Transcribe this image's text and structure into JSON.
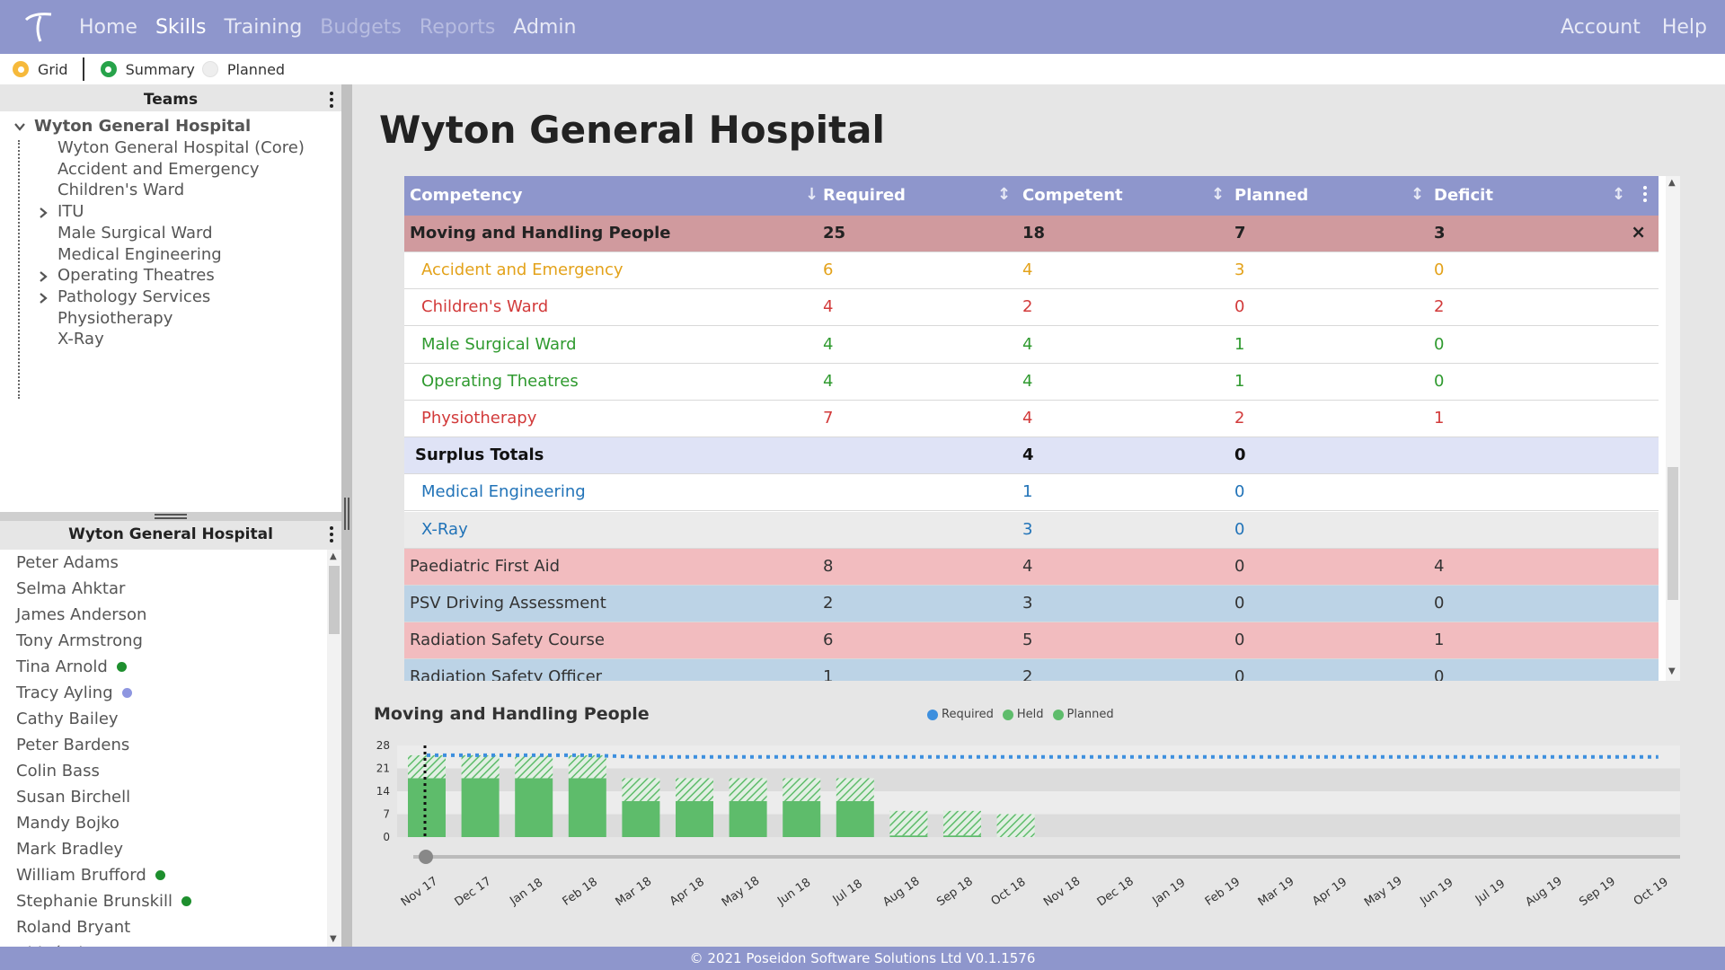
{
  "nav": {
    "items": [
      {
        "label": "Home",
        "state": "normal"
      },
      {
        "label": "Skills",
        "state": "active"
      },
      {
        "label": "Training",
        "state": "normal"
      },
      {
        "label": "Budgets",
        "state": "disabled"
      },
      {
        "label": "Reports",
        "state": "disabled"
      },
      {
        "label": "Admin",
        "state": "normal"
      }
    ],
    "right": [
      {
        "label": "Account"
      },
      {
        "label": "Help"
      }
    ]
  },
  "toolbar": {
    "grid": "Grid",
    "summary": "Summary",
    "planned": "Planned"
  },
  "teams": {
    "header": "Teams",
    "root": "Wyton General Hospital",
    "items": [
      {
        "label": "Wyton General Hospital (Core)",
        "expandable": false
      },
      {
        "label": "Accident and Emergency",
        "expandable": false
      },
      {
        "label": "Children's Ward",
        "expandable": false
      },
      {
        "label": "ITU",
        "expandable": true
      },
      {
        "label": "Male Surgical Ward",
        "expandable": false
      },
      {
        "label": "Medical Engineering",
        "expandable": false
      },
      {
        "label": "Operating Theatres",
        "expandable": true
      },
      {
        "label": "Pathology Services",
        "expandable": true
      },
      {
        "label": "Physiotherapy",
        "expandable": false
      },
      {
        "label": "X-Ray",
        "expandable": false
      }
    ]
  },
  "people": {
    "header": "Wyton General Hospital",
    "items": [
      {
        "name": "Peter Adams",
        "dot": ""
      },
      {
        "name": "Selma Ahktar",
        "dot": ""
      },
      {
        "name": "James Anderson",
        "dot": ""
      },
      {
        "name": "Tony Armstrong",
        "dot": ""
      },
      {
        "name": "Tina Arnold",
        "dot": "#1e8f2e"
      },
      {
        "name": "Tracy Ayling",
        "dot": "#8e96e0"
      },
      {
        "name": "Cathy Bailey",
        "dot": ""
      },
      {
        "name": "Peter Bardens",
        "dot": ""
      },
      {
        "name": "Colin Bass",
        "dot": ""
      },
      {
        "name": "Susan Birchell",
        "dot": ""
      },
      {
        "name": "Mandy Bojko",
        "dot": ""
      },
      {
        "name": "Mark Bradley",
        "dot": ""
      },
      {
        "name": "William Brufford",
        "dot": "#1e8f2e"
      },
      {
        "name": "Stephanie Brunskill",
        "dot": "#1e8f2e"
      },
      {
        "name": "Roland Bryant",
        "dot": ""
      },
      {
        "name": "Chloé Ch...",
        "dot": ""
      }
    ]
  },
  "main": {
    "title": "Wyton General Hospital",
    "columns": [
      "Competency",
      "Required",
      "Competent",
      "Planned",
      "Deficit"
    ],
    "rows": [
      {
        "type": "selected",
        "cells": [
          "Moving and Handling People",
          "25",
          "18",
          "7",
          "3"
        ],
        "bg": "#d09a9e",
        "color": "#222"
      },
      {
        "type": "sub",
        "cells": [
          "Accident and Emergency",
          "6",
          "4",
          "3",
          "0"
        ],
        "bg": "#ffffff",
        "color": "#e3a21a"
      },
      {
        "type": "sub",
        "cells": [
          "Children's Ward",
          "4",
          "2",
          "0",
          "2"
        ],
        "bg": "#ffffff",
        "color": "#d23a3a"
      },
      {
        "type": "sub",
        "cells": [
          "Male Surgical Ward",
          "4",
          "4",
          "1",
          "0"
        ],
        "bg": "#ffffff",
        "color": "#2f9a2f"
      },
      {
        "type": "sub",
        "cells": [
          "Operating Theatres",
          "4",
          "4",
          "1",
          "0"
        ],
        "bg": "#ffffff",
        "color": "#2f9a2f"
      },
      {
        "type": "sub",
        "cells": [
          "Physiotherapy",
          "7",
          "4",
          "2",
          "1"
        ],
        "bg": "#ffffff",
        "color": "#d23a3a"
      },
      {
        "type": "surplus",
        "cells": [
          "Surplus Totals",
          "",
          "4",
          "0",
          ""
        ],
        "bg": "#dfe3f6",
        "color": "#111"
      },
      {
        "type": "sub",
        "cells": [
          "Medical Engineering",
          "",
          "1",
          "0",
          ""
        ],
        "bg": "#ffffff",
        "color": "#2173b8"
      },
      {
        "type": "sub",
        "cells": [
          "X-Ray",
          "",
          "3",
          "0",
          ""
        ],
        "bg": "#ebebeb",
        "color": "#2173b8"
      },
      {
        "type": "main",
        "cells": [
          "Paediatric First Aid",
          "8",
          "4",
          "0",
          "4"
        ],
        "bg": "#f2bcbf",
        "color": "#333"
      },
      {
        "type": "main",
        "cells": [
          "PSV Driving Assessment",
          "2",
          "3",
          "0",
          "0"
        ],
        "bg": "#bcd3e6",
        "color": "#333"
      },
      {
        "type": "main",
        "cells": [
          "Radiation Safety Course",
          "6",
          "5",
          "0",
          "1"
        ],
        "bg": "#f2bcbf",
        "color": "#333"
      },
      {
        "type": "main",
        "cells": [
          "Radiation Safety Officer",
          "1",
          "2",
          "0",
          "0"
        ],
        "bg": "#bcd3e6",
        "color": "#333"
      }
    ]
  },
  "chart_data": {
    "type": "bar",
    "title": "Moving and Handling People",
    "legend": [
      "Required",
      "Held",
      "Planned"
    ],
    "legend_colors": {
      "Required": "#3d8fde",
      "Held": "#5ebc6b",
      "Planned": "#5ebc6b"
    },
    "categories": [
      "Nov 17",
      "Dec 17",
      "Jan 18",
      "Feb 18",
      "Mar 18",
      "Apr 18",
      "May 18",
      "Jun 18",
      "Jul 18",
      "Aug 18",
      "Sep 18",
      "Oct 18",
      "Nov 18",
      "Dec 18",
      "Jan 19",
      "Feb 19",
      "Mar 19",
      "Apr 19",
      "May 19",
      "Jun 19",
      "Jul 19",
      "Aug 19",
      "Sep 19",
      "Oct 19"
    ],
    "series": [
      {
        "name": "Held",
        "values": [
          18,
          18,
          18,
          18,
          11,
          11,
          11,
          11,
          11,
          0.5,
          0.5,
          0,
          null,
          null,
          null,
          null,
          null,
          null,
          null,
          null,
          null,
          null,
          null,
          null
        ]
      },
      {
        "name": "Planned",
        "values": [
          7,
          7,
          7,
          7,
          7,
          7,
          7,
          7,
          7,
          7.5,
          7.5,
          7,
          null,
          null,
          null,
          null,
          null,
          null,
          null,
          null,
          null,
          null,
          null,
          null
        ]
      },
      {
        "name": "Required",
        "values": [
          25,
          25,
          25,
          25,
          24.5,
          24.5,
          24.5,
          24.5,
          24.5,
          24.5,
          24.5,
          24.5,
          24.5,
          24.5,
          24.5,
          24.5,
          24.5,
          24.5,
          24.5,
          24.5,
          24.5,
          24.5,
          24.5,
          24.5
        ]
      }
    ],
    "yticks": [
      0,
      7,
      14,
      21,
      28
    ],
    "ylim": [
      0,
      28
    ]
  },
  "footer": "© 2021 Poseidon Software Solutions Ltd V0.1.1576"
}
